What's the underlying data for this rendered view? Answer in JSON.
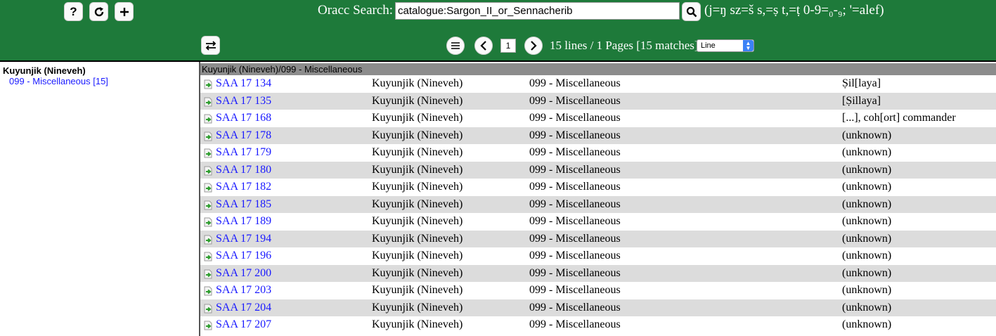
{
  "header": {
    "search_label": "Oracc Search:",
    "search_value": "catalogue:Sargon_II_or_Sennacherib",
    "hint": "(j=ŋ sz=š s,=ṣ t,=ṭ 0-9=₀-₉; '=alef)",
    "page_value": "1",
    "status": "15 lines / 1 Pages [15 matches]",
    "view_select": "Line"
  },
  "icons": [
    "help-icon",
    "refresh-icon",
    "plus-icon",
    "search-icon",
    "swap-icon",
    "menu-icon",
    "chevron-left-icon",
    "chevron-right-icon",
    "select-arrows-icon",
    "item-arrow-icon"
  ],
  "colors": {
    "header_bg": "#1e7a3a",
    "link": "#1a1aff",
    "group_header_bg": "#8c8c8c",
    "row_alt": "#dcdcdc"
  },
  "sidebar": {
    "title": "Kuyunjik (Nineveh)",
    "link": "099 - Miscellaneous [15]"
  },
  "group_header": "Kuyunjik (Nineveh)/099 - Miscellaneous",
  "rows": [
    {
      "id": "SAA 17 134",
      "place": "Kuyunjik (Nineveh)",
      "category": "099 - Miscellaneous",
      "note": "Ṣil[laya]"
    },
    {
      "id": "SAA 17 135",
      "place": "Kuyunjik (Nineveh)",
      "category": "099 - Miscellaneous",
      "note": "[Ṣillaya]"
    },
    {
      "id": "SAA 17 168",
      "place": "Kuyunjik (Nineveh)",
      "category": "099 - Miscellaneous",
      "note": "[...], coh[ort] commander"
    },
    {
      "id": "SAA 17 178",
      "place": "Kuyunjik (Nineveh)",
      "category": "099 - Miscellaneous",
      "note": "(unknown)"
    },
    {
      "id": "SAA 17 179",
      "place": "Kuyunjik (Nineveh)",
      "category": "099 - Miscellaneous",
      "note": "(unknown)"
    },
    {
      "id": "SAA 17 180",
      "place": "Kuyunjik (Nineveh)",
      "category": "099 - Miscellaneous",
      "note": "(unknown)"
    },
    {
      "id": "SAA 17 182",
      "place": "Kuyunjik (Nineveh)",
      "category": "099 - Miscellaneous",
      "note": "(unknown)"
    },
    {
      "id": "SAA 17 185",
      "place": "Kuyunjik (Nineveh)",
      "category": "099 - Miscellaneous",
      "note": "(unknown)"
    },
    {
      "id": "SAA 17 189",
      "place": "Kuyunjik (Nineveh)",
      "category": "099 - Miscellaneous",
      "note": "(unknown)"
    },
    {
      "id": "SAA 17 194",
      "place": "Kuyunjik (Nineveh)",
      "category": "099 - Miscellaneous",
      "note": "(unknown)"
    },
    {
      "id": "SAA 17 196",
      "place": "Kuyunjik (Nineveh)",
      "category": "099 - Miscellaneous",
      "note": "(unknown)"
    },
    {
      "id": "SAA 17 200",
      "place": "Kuyunjik (Nineveh)",
      "category": "099 - Miscellaneous",
      "note": "(unknown)"
    },
    {
      "id": "SAA 17 203",
      "place": "Kuyunjik (Nineveh)",
      "category": "099 - Miscellaneous",
      "note": "(unknown)"
    },
    {
      "id": "SAA 17 204",
      "place": "Kuyunjik (Nineveh)",
      "category": "099 - Miscellaneous",
      "note": "(unknown)"
    },
    {
      "id": "SAA 17 207",
      "place": "Kuyunjik (Nineveh)",
      "category": "099 - Miscellaneous",
      "note": "(unknown)"
    }
  ]
}
